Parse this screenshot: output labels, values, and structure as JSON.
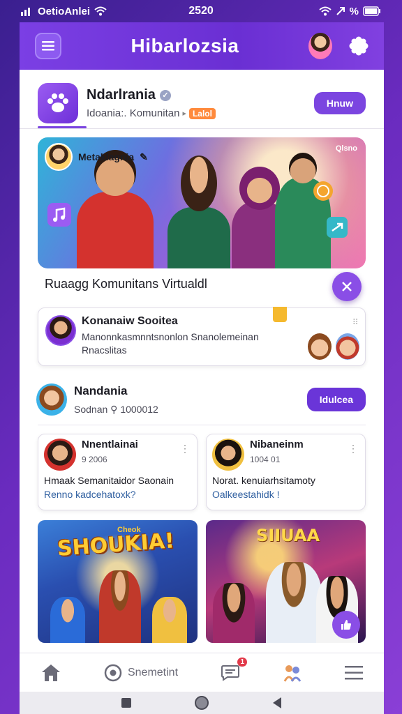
{
  "status_bar": {
    "carrier": "OetioAnlei",
    "time": "2520",
    "battery": "%"
  },
  "header": {
    "title": "Hibarlozsia"
  },
  "community": {
    "name": "Ndarlrania",
    "subtitle": "Idoania:. Komunitan",
    "badge": "Lalol",
    "join_label": "Hnuw"
  },
  "hero": {
    "tag": "Metaklagnia",
    "corner": "Qlsno",
    "caption": "Ruaagg Komunitans Virtualdl"
  },
  "notice": {
    "title": "Konanaiw Sooitea",
    "line1": "Manonnkasmnntsnonlon Snanolemeinan",
    "line2": "Rnacslitas"
  },
  "section": {
    "name": "Nandania",
    "sub": "Sodnan",
    "count": "1000012",
    "follow_label": "Idulcea"
  },
  "posts": [
    {
      "name": "Nnentlainai",
      "meta": "9 2006",
      "line1": "Hmaak Semanitaidor Saonain",
      "line2": "Renno kadcehatoxk?"
    },
    {
      "name": "Nibaneinm",
      "meta": "1004 01",
      "line1": "Norat. kenuiarhsitamoty",
      "line2": "Oalkeestahidk !"
    }
  ],
  "media": [
    {
      "title": "SHOUKIA!",
      "small": "Cheok"
    },
    {
      "title": "SIIUAA"
    }
  ],
  "bottom_nav": {
    "home": "",
    "discover_label": "Snemetint",
    "messages_badge": "1"
  },
  "colors": {
    "brand": "#7b45e0",
    "header": "#6a2fd3",
    "badge": "#e23a4a"
  }
}
